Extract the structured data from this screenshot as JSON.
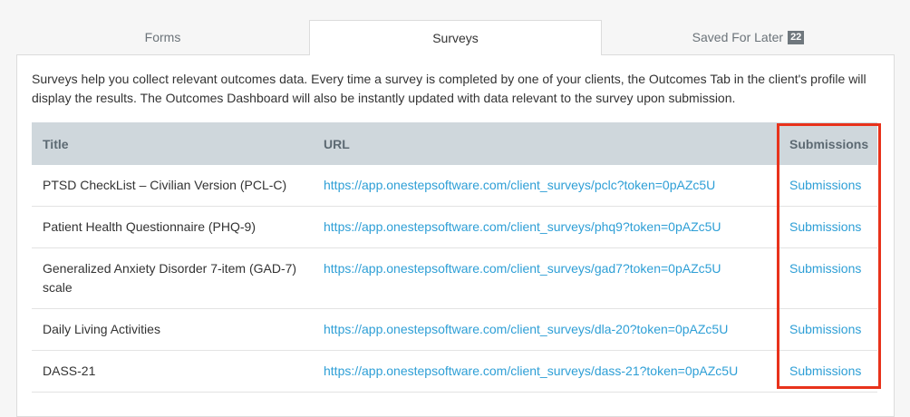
{
  "tabs": [
    {
      "label": "Forms",
      "active": false
    },
    {
      "label": "Surveys",
      "active": true
    },
    {
      "label": "Saved For Later",
      "badge": "22",
      "active": false
    }
  ],
  "intro": "Surveys help you collect relevant outcomes data. Every time a survey is completed by one of your clients, the Outcomes Tab in the client's profile will display the results. The Outcomes Dashboard will also be instantly updated with data relevant to the survey upon submission.",
  "table": {
    "headers": {
      "title": "Title",
      "url": "URL",
      "submissions": "Submissions"
    },
    "rows": [
      {
        "title": "PTSD CheckList – Civilian Version (PCL-C)",
        "url": "https://app.onestepsoftware.com/client_surveys/pclc?token=0pAZc5U",
        "submissions": "Submissions"
      },
      {
        "title": "Patient Health Questionnaire (PHQ-9)",
        "url": "https://app.onestepsoftware.com/client_surveys/phq9?token=0pAZc5U",
        "submissions": "Submissions"
      },
      {
        "title": "Generalized Anxiety Disorder 7-item (GAD-7) scale",
        "url": "https://app.onestepsoftware.com/client_surveys/gad7?token=0pAZc5U",
        "submissions": "Submissions"
      },
      {
        "title": "Daily Living Activities",
        "url": "https://app.onestepsoftware.com/client_surveys/dla-20?token=0pAZc5U",
        "submissions": "Submissions"
      },
      {
        "title": "DASS-21",
        "url": "https://app.onestepsoftware.com/client_surveys/dass-21?token=0pAZc5U",
        "submissions": "Submissions"
      }
    ]
  },
  "colors": {
    "link": "#2e9fd6",
    "header_bg": "#cfd7dc",
    "highlight": "#e8321b"
  }
}
